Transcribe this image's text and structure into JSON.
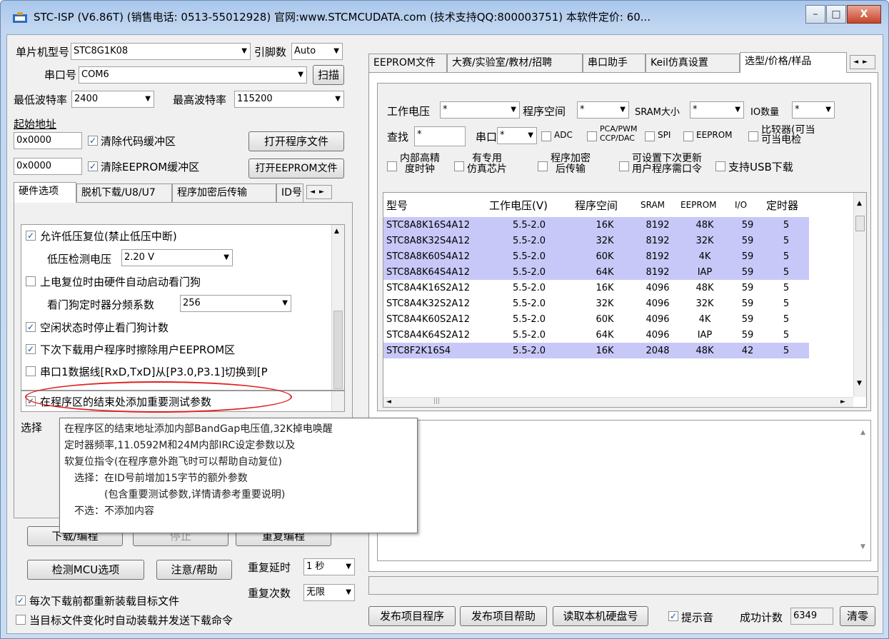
{
  "window": {
    "title": "STC-ISP (V6.86T) (销售电话: 0513-55012928) 官网:www.STCMCUDATA.com  (技术支持QQ:800003751) 本软件定价: 60...",
    "minimize": "–",
    "maximize": "□",
    "close": "X"
  },
  "left": {
    "mcu_label": "单片机型号",
    "mcu_value": "STC8G1K08",
    "pins_label": "引脚数",
    "pins_value": "Auto",
    "port_label": "串口号",
    "port_value": "COM6",
    "scan_button": "扫描",
    "min_baud_label": "最低波特率",
    "min_baud_value": "2400",
    "max_baud_label": "最高波特率",
    "max_baud_value": "115200",
    "start_addr_label": "起始地址",
    "code_addr": "0x0000",
    "clear_code_label": "清除代码缓冲区",
    "open_program_button": "打开程序文件",
    "eeprom_addr": "0x0000",
    "clear_eeprom_label": "清除EEPROM缓冲区",
    "open_eeprom_button": "打开EEPROM文件",
    "tabs": [
      "硬件选项",
      "脱机下载/U8/U7",
      "程序加密后传输",
      "ID号"
    ],
    "options": {
      "low_voltage_reset": "允许低压复位(禁止低压中断)",
      "low_voltage_label": "低压检测电压",
      "low_voltage_value": "2.20 V",
      "watchdog_poweron": "上电复位时由硬件自动启动看门狗",
      "watchdog_div_label": "看门狗定时器分频系数",
      "watchdog_div_value": "256",
      "idle_stop_watchdog": "空闲状态时停止看门狗计数",
      "erase_eeprom": "下次下载用户程序时擦除用户EEPROM区",
      "uart_switch": "串口1数据线[RxD,TxD]从[P3.0,P3.1]切换到[P",
      "add_test_params": "在程序区的结束处添加重要测试参数",
      "select_partial": "选择"
    },
    "download_button": "下载/编程",
    "stop_button": "停止",
    "repeat_button": "重复编程",
    "detect_button": "检测MCU选项",
    "help_button": "注意/帮助",
    "repeat_delay_label": "重复延时",
    "repeat_delay_value": "1 秒",
    "repeat_count_label": "重复次数",
    "repeat_count_value": "无限",
    "reload_label": "每次下载前都重新装载目标文件",
    "auto_load_label": "当目标文件变化时自动装载并发送下载命令"
  },
  "tooltip": {
    "lines": [
      "在程序区的结束地址添加内部BandGap电压值,32K掉电唤醒",
      "定时器频率,11.0592M和24M内部IRC设定参数以及",
      "软复位指令(在程序意外跑飞时可以帮助自动复位)",
      "选择：在ID号前增加15字节的额外参数",
      "(包含重要测试参数,详情请参考重要说明)",
      "不选：不添加内容"
    ]
  },
  "right": {
    "tabs": [
      "EEPROM文件",
      "大赛/实验室/教材/招聘",
      "串口助手",
      "Keil仿真设置",
      "选型/价格/样品"
    ],
    "filters": {
      "voltage_label": "工作电压",
      "voltage_value": "*",
      "prog_label": "程序空间",
      "prog_value": "*",
      "sram_label": "SRAM大小",
      "sram_value": "*",
      "io_label": "IO数量",
      "io_value": "*",
      "search_label": "查找",
      "search_value": "*",
      "uart_label": "串口",
      "uart_value": "*",
      "adc": "ADC",
      "pca_line1": "PCA/PWM",
      "pca_line2": "CCP/DAC",
      "spi": "SPI",
      "eeprom": "EEPROM",
      "cmp_line1": "比较器",
      "cmp_line2": "可当电检",
      "cmp_extra1": "(可当",
      "osc_line1": "内部高精",
      "osc_line2": "度时钟",
      "emu_line1": "有专用",
      "emu_line2": "仿真芯片",
      "enc_line1": "程序加密",
      "enc_line2": "后传输",
      "upd_line1": "可设置下次更新",
      "upd_line2": "用户程序需口令",
      "usb": "支持USB下载"
    },
    "table": {
      "headers": [
        "型号",
        "工作电压(V)",
        "程序空间",
        "SRAM",
        "EEPROM",
        "I/O",
        "定时器"
      ],
      "rows": [
        {
          "model": "STC8A8K16S4A12",
          "voltage": "5.5-2.0",
          "flash": "16K",
          "sram": "8192",
          "eeprom": "48K",
          "io": "59",
          "timers": "5",
          "sel": true
        },
        {
          "model": "STC8A8K32S4A12",
          "voltage": "5.5-2.0",
          "flash": "32K",
          "sram": "8192",
          "eeprom": "32K",
          "io": "59",
          "timers": "5",
          "sel": true
        },
        {
          "model": "STC8A8K60S4A12",
          "voltage": "5.5-2.0",
          "flash": "60K",
          "sram": "8192",
          "eeprom": "4K",
          "io": "59",
          "timers": "5",
          "sel": true
        },
        {
          "model": "STC8A8K64S4A12",
          "voltage": "5.5-2.0",
          "flash": "64K",
          "sram": "8192",
          "eeprom": "IAP",
          "io": "59",
          "timers": "5",
          "sel": true
        },
        {
          "model": "STC8A4K16S2A12",
          "voltage": "5.5-2.0",
          "flash": "16K",
          "sram": "4096",
          "eeprom": "48K",
          "io": "59",
          "timers": "5",
          "sel": false
        },
        {
          "model": "STC8A4K32S2A12",
          "voltage": "5.5-2.0",
          "flash": "32K",
          "sram": "4096",
          "eeprom": "32K",
          "io": "59",
          "timers": "5",
          "sel": false
        },
        {
          "model": "STC8A4K60S2A12",
          "voltage": "5.5-2.0",
          "flash": "60K",
          "sram": "4096",
          "eeprom": "4K",
          "io": "59",
          "timers": "5",
          "sel": false
        },
        {
          "model": "STC8A4K64S2A12",
          "voltage": "5.5-2.0",
          "flash": "64K",
          "sram": "4096",
          "eeprom": "IAP",
          "io": "59",
          "timers": "5",
          "sel": false
        },
        {
          "model": "STC8F2K16S4",
          "voltage": "5.5-2.0",
          "flash": "16K",
          "sram": "2048",
          "eeprom": "48K",
          "io": "42",
          "timers": "5",
          "sel": true
        }
      ]
    },
    "bottom_buttons": {
      "publish": "发布项目程序",
      "publish_help": "发布项目帮助",
      "read_disk": "读取本机硬盘号",
      "sound_label": "提示音",
      "success_label": "成功计数",
      "success_count": "6349",
      "clear": "清零"
    }
  }
}
